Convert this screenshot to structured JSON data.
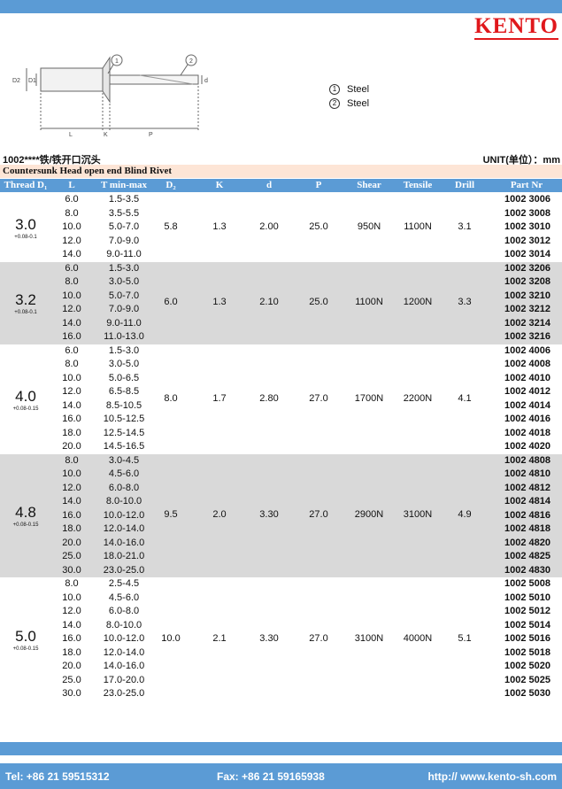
{
  "logo": "KENTO",
  "legend": [
    {
      "num": "1",
      "label": "Steel"
    },
    {
      "num": "2",
      "label": "Steel"
    }
  ],
  "drawing_labels": {
    "d2": "D2",
    "d1": "D1",
    "l": "L",
    "k": "K",
    "p": "P",
    "d": "d",
    "c1": "1",
    "c2": "2"
  },
  "code_line": "1002****铁/铁开口沉头",
  "unit": "UNIT(单位）：mm",
  "product_title": "Countersunk Head open end Blind Rivet",
  "headers": {
    "thread": "Thread D₁",
    "l": "L",
    "t": "T min-max",
    "d2": "D₂",
    "k": "K",
    "d": "d",
    "p": "P",
    "shear": "Shear",
    "tensile": "Tensile",
    "drill": "Drill",
    "part": "Part Nr"
  },
  "groups": [
    {
      "thread": "3.0",
      "tol": "+0.08-0.1",
      "d2": "5.8",
      "k": "1.3",
      "d": "2.00",
      "p": "25.0",
      "shear": "950N",
      "tensile": "1100N",
      "drill": "3.1",
      "rows": [
        [
          "6.0",
          "1.5-3.5",
          "1002 3006"
        ],
        [
          "8.0",
          "3.5-5.5",
          "1002 3008"
        ],
        [
          "10.0",
          "5.0-7.0",
          "1002 3010"
        ],
        [
          "12.0",
          "7.0-9.0",
          "1002 3012"
        ],
        [
          "14.0",
          "9.0-11.0",
          "1002 3014"
        ]
      ]
    },
    {
      "thread": "3.2",
      "tol": "+0.08-0.1",
      "d2": "6.0",
      "k": "1.3",
      "d": "2.10",
      "p": "25.0",
      "shear": "1100N",
      "tensile": "1200N",
      "drill": "3.3",
      "rows": [
        [
          "6.0",
          "1.5-3.0",
          "1002 3206"
        ],
        [
          "8.0",
          "3.0-5.0",
          "1002 3208"
        ],
        [
          "10.0",
          "5.0-7.0",
          "1002 3210"
        ],
        [
          "12.0",
          "7.0-9.0",
          "1002 3212"
        ],
        [
          "14.0",
          "9.0-11.0",
          "1002 3214"
        ],
        [
          "16.0",
          "11.0-13.0",
          "1002 3216"
        ]
      ]
    },
    {
      "thread": "4.0",
      "tol": "+0.08-0.15",
      "d2": "8.0",
      "k": "1.7",
      "d": "2.80",
      "p": "27.0",
      "shear": "1700N",
      "tensile": "2200N",
      "drill": "4.1",
      "rows": [
        [
          "6.0",
          "1.5-3.0",
          "1002 4006"
        ],
        [
          "8.0",
          "3.0-5.0",
          "1002 4008"
        ],
        [
          "10.0",
          "5.0-6.5",
          "1002 4010"
        ],
        [
          "12.0",
          "6.5-8.5",
          "1002 4012"
        ],
        [
          "14.0",
          "8.5-10.5",
          "1002 4014"
        ],
        [
          "16.0",
          "10.5-12.5",
          "1002 4016"
        ],
        [
          "18.0",
          "12.5-14.5",
          "1002 4018"
        ],
        [
          "20.0",
          "14.5-16.5",
          "1002 4020"
        ]
      ]
    },
    {
      "thread": "4.8",
      "tol": "+0.08-0.15",
      "d2": "9.5",
      "k": "2.0",
      "d": "3.30",
      "p": "27.0",
      "shear": "2900N",
      "tensile": "3100N",
      "drill": "4.9",
      "rows": [
        [
          "8.0",
          "3.0-4.5",
          "1002 4808"
        ],
        [
          "10.0",
          "4.5-6.0",
          "1002 4810"
        ],
        [
          "12.0",
          "6.0-8.0",
          "1002 4812"
        ],
        [
          "14.0",
          "8.0-10.0",
          "1002 4814"
        ],
        [
          "16.0",
          "10.0-12.0",
          "1002 4816"
        ],
        [
          "18.0",
          "12.0-14.0",
          "1002 4818"
        ],
        [
          "20.0",
          "14.0-16.0",
          "1002 4820"
        ],
        [
          "25.0",
          "18.0-21.0",
          "1002 4825"
        ],
        [
          "30.0",
          "23.0-25.0",
          "1002 4830"
        ]
      ]
    },
    {
      "thread": "5.0",
      "tol": "+0.08-0.15",
      "d2": "10.0",
      "k": "2.1",
      "d": "3.30",
      "p": "27.0",
      "shear": "3100N",
      "tensile": "4000N",
      "drill": "5.1",
      "rows": [
        [
          "8.0",
          "2.5-4.5",
          "1002 5008"
        ],
        [
          "10.0",
          "4.5-6.0",
          "1002 5010"
        ],
        [
          "12.0",
          "6.0-8.0",
          "1002 5012"
        ],
        [
          "14.0",
          "8.0-10.0",
          "1002 5014"
        ],
        [
          "16.0",
          "10.0-12.0",
          "1002 5016"
        ],
        [
          "18.0",
          "12.0-14.0",
          "1002 5018"
        ],
        [
          "20.0",
          "14.0-16.0",
          "1002 5020"
        ],
        [
          "25.0",
          "17.0-20.0",
          "1002 5025"
        ],
        [
          "30.0",
          "23.0-25.0",
          "1002 5030"
        ]
      ]
    }
  ],
  "footer": {
    "tel": "Tel: +86 21 59515312",
    "fax": "Fax: +86 21 59165938",
    "web": "http:// www.kento-sh.com"
  }
}
